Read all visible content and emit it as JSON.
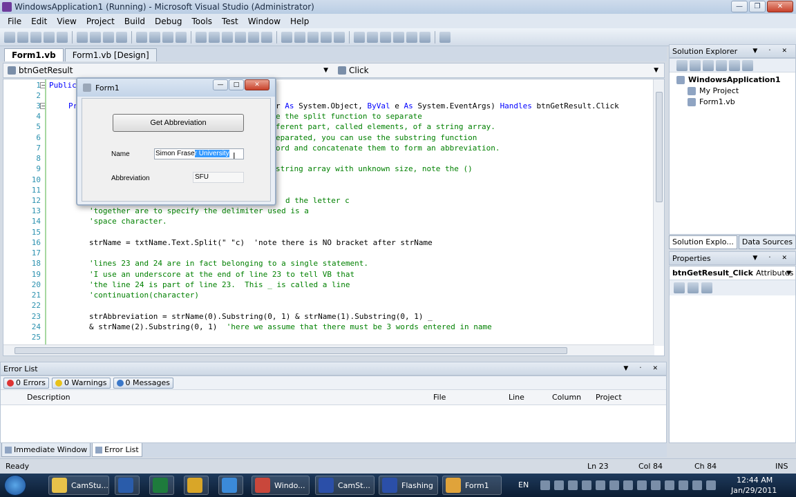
{
  "window": {
    "title": "WindowsApplication1 (Running) - Microsoft Visual Studio (Administrator)"
  },
  "menu": [
    "File",
    "Edit",
    "View",
    "Project",
    "Build",
    "Debug",
    "Tools",
    "Test",
    "Window",
    "Help"
  ],
  "doc_tabs": [
    "Form1.vb",
    "Form1.vb [Design]"
  ],
  "nav": {
    "object": "btnGetResult",
    "event": "Click"
  },
  "code": {
    "line_numbers": [
      "1",
      "2",
      "3",
      "4",
      "5",
      "6",
      "7",
      "8",
      "9",
      "10",
      "11",
      "12",
      "13",
      "14",
      "15",
      "16",
      "17",
      "18",
      "19",
      "20",
      "21",
      "22",
      "23",
      "24",
      "25"
    ],
    "line1": "Public",
    "line3_kw_pr": "Pr",
    "line3_a": "r ",
    "line3_as1": "As",
    "line3_b": " System.Object, ",
    "line3_byval": "ByVal",
    "line3_c": " e ",
    "line3_as2": "As",
    "line3_d": " System.EventArgs) ",
    "line3_handles": "Handles",
    "line3_e": " btnGetResult.Click",
    "line4": "e the split function to separate",
    "line5": "ferent part, called elements, of a string array.",
    "line6": "eparated, you can use the substring function",
    "line7": "ord and concatenate them to form an abbreviation.",
    "line9": "string array with unknown size, note the ()",
    "line12": "d the letter c",
    "line13": "'together are to specify the delimiter used is a",
    "line14": "'space character.",
    "line16": "strName = txtName.Text.Split(\" \"c)  'note there is NO bracket after strName",
    "line18": "'lines 23 and 24 are in fact belonging to a single statement.",
    "line19": "'I use an underscore at the end of line 23 to tell VB that",
    "line20": "'the line 24 is part of line 23.  This _ is called a line",
    "line21": "'continuation(character)",
    "line23": "strAbbreviation = strName(0).Substring(0, 1) & strName(1).Substring(0, 1) _",
    "line24_code": "& strName(2).Substring(0, 1)  ",
    "line24_comment": "'here we assume that there must be 3 words entered in name"
  },
  "form1": {
    "title": "Form1",
    "button": "Get Abbreviation",
    "name_label": "Name",
    "name_value_plain": "Simon Frase",
    "name_value_selected": "r University",
    "abbr_label": "Abbreviation",
    "abbr_value": "SFU"
  },
  "solution_explorer": {
    "title": "Solution Explorer",
    "root": "WindowsApplication1",
    "items": [
      "My Project",
      "Form1.vb"
    ],
    "tabs": [
      "Solution Explo...",
      "Data Sources"
    ]
  },
  "properties": {
    "title": "Properties",
    "object": "btnGetResult_Click",
    "object_type": "Attributes"
  },
  "error_list": {
    "title": "Error List",
    "filters": [
      "0 Errors",
      "0 Warnings",
      "0 Messages"
    ],
    "columns": [
      "Description",
      "File",
      "Line",
      "Column",
      "Project"
    ]
  },
  "bottom_tabs": [
    "Immediate Window",
    "Error List"
  ],
  "status": {
    "left": "Ready",
    "ln": "Ln 23",
    "col": "Col 84",
    "ch": "Ch 84",
    "ins": "INS"
  },
  "taskbar": {
    "buttons": [
      "CamStu...",
      "Windo...",
      "CamSt...",
      "Flashing",
      "Form1"
    ],
    "lang": "EN",
    "time": "12:44 AM",
    "date": "Jan/29/2011"
  },
  "colors": {
    "comment": "#008000",
    "keyword": "#0000ff",
    "line_number": "#2b91af",
    "selection": "#3399ff"
  }
}
